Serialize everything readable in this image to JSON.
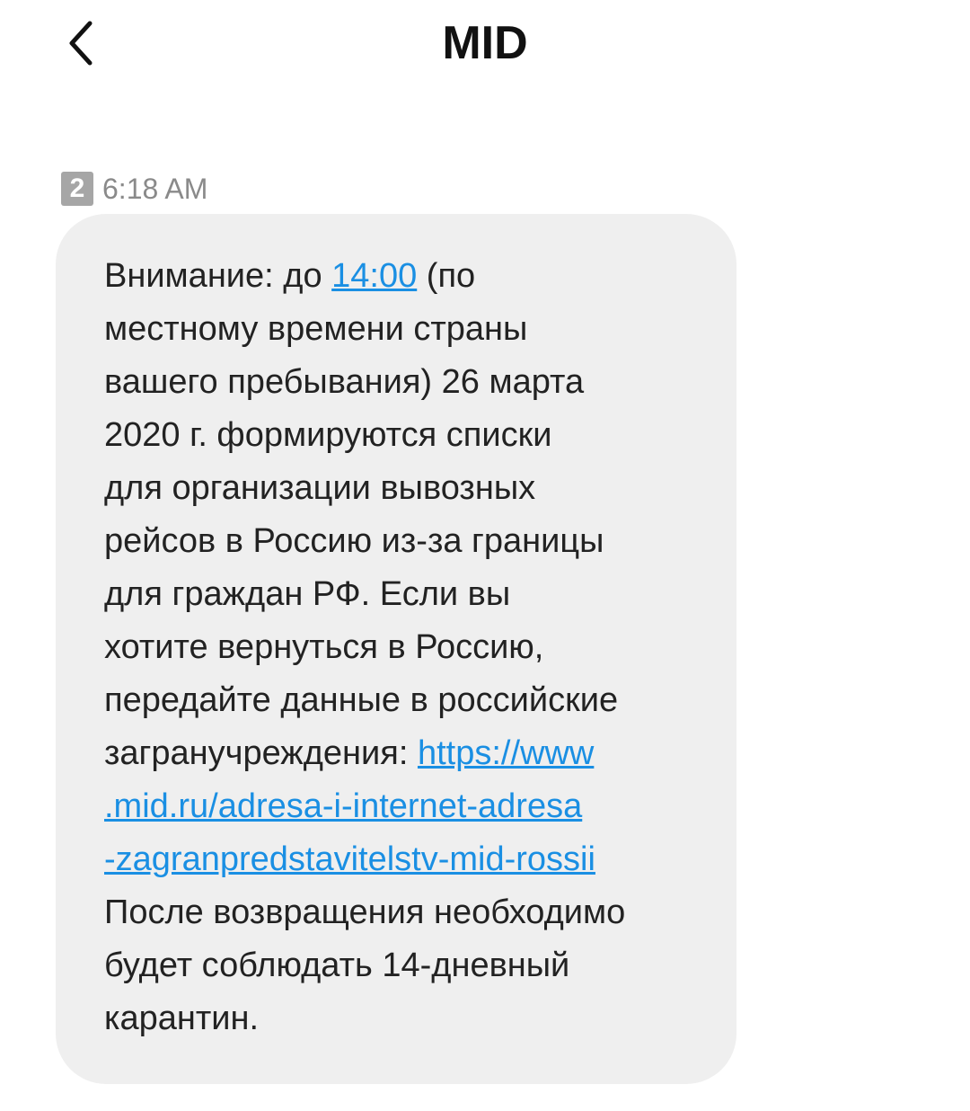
{
  "header": {
    "title": "MID",
    "back_icon": "chevron-left-icon"
  },
  "message": {
    "sim_slot": "2",
    "time": "6:18 AM",
    "lines": [
      [
        "Внимание: до ",
        "14:00",
        " (по"
      ],
      [
        "местному времени страны"
      ],
      [
        "вашего пребывания) 26 марта"
      ],
      [
        "2020 г. формируются списки"
      ],
      [
        "для организации вывозных"
      ],
      [
        "рейсов в Россию из-за границы"
      ],
      [
        "для граждан РФ. Если вы"
      ],
      [
        "хотите вернуться в Россию,"
      ],
      [
        "передайте данные в российские"
      ],
      [
        "загранучреждения: ",
        "https://www"
      ],
      [
        ".mid.ru/adresa-i-internet-adresa"
      ],
      [
        "-zagranpredstavitelstv-mid-rossii"
      ],
      [
        "После возвращения необходимо"
      ],
      [
        "будет соблюдать 14-дневный"
      ],
      [
        "карантин."
      ]
    ]
  },
  "colors": {
    "link": "#1a8fe3",
    "bubble": "#efefef",
    "badge": "#a6a6a6"
  }
}
